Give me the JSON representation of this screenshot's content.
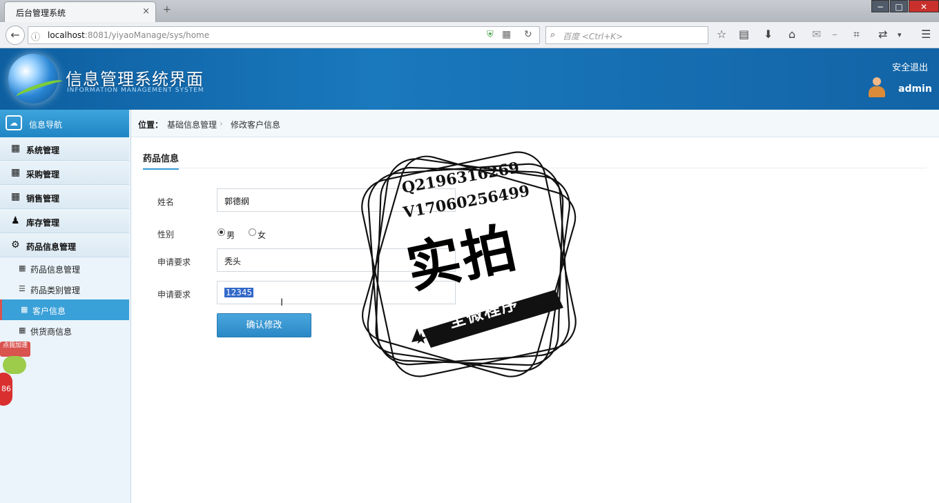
{
  "browser": {
    "tab_title": "后台管理系统",
    "tab_close": "×",
    "new_tab": "+",
    "url_host": "localhost",
    "url_rest": ":8081/yiyaoManage/sys/home",
    "search_placeholder": "百度 <Ctrl+K>",
    "window_buttons": {
      "minimize": "−",
      "maximize": "□",
      "close": "✕"
    }
  },
  "header": {
    "title": "信息管理系统界面",
    "subtitle": "INFORMATION MANAGEMENT SYSTEM",
    "logout": "安全退出",
    "username": "admin"
  },
  "sidebar": {
    "head_label": "信息导航",
    "menus": [
      {
        "label": "系统管理",
        "icon": "calendar-icon"
      },
      {
        "label": "采购管理",
        "icon": "calendar-icon"
      },
      {
        "label": "销售管理",
        "icon": "calendar-icon"
      },
      {
        "label": "库存管理",
        "icon": "user-icon"
      },
      {
        "label": "药品信息管理",
        "icon": "gears-icon"
      }
    ],
    "submenus": [
      {
        "label": "药品信息管理",
        "icon": "grid-icon",
        "active": false
      },
      {
        "label": "药品类别管理",
        "icon": "list-icon",
        "active": false
      },
      {
        "label": "客户信息",
        "icon": "grid-icon",
        "active": true
      },
      {
        "label": "供货商信息",
        "icon": "grid-icon",
        "active": false
      }
    ],
    "float_badge": "点我加速",
    "float_ball": "86"
  },
  "breadcrumb": {
    "label": "位置：",
    "level1": "基础信息管理",
    "separator": "›",
    "level2": "修改客户信息"
  },
  "form": {
    "section_title": "药品信息",
    "fields": {
      "name_label": "姓名",
      "name_value": "郭德纲",
      "gender_label": "性别",
      "gender_male": "男",
      "gender_female": "女",
      "gender_selected": "男",
      "req1_label": "申请要求",
      "req1_value": "秃头",
      "req2_label": "申请要求",
      "req2_value": "12345"
    },
    "submit_label": "确认修改"
  },
  "watermark": {
    "line1": "Q2196316269",
    "line2": "V17060256499",
    "big": "实拍",
    "ribbon": "全微程序"
  },
  "colors": {
    "header_blue": "#1a78bd",
    "sidebar_active": "#3aa0d8",
    "button_blue": "#2a88c6"
  }
}
